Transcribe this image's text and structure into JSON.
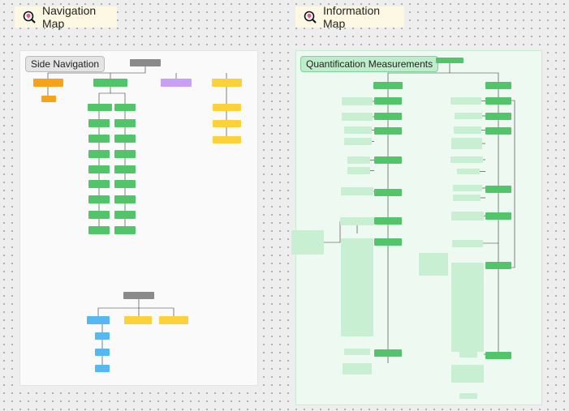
{
  "sections": {
    "navigation_map": {
      "title": "Navigation Map"
    },
    "information_map": {
      "title": "Information Map"
    }
  },
  "frames": {
    "side_navigation": {
      "label": "Side Navigation"
    },
    "quantification": {
      "label": "Quantification Measurements"
    }
  },
  "colors": {
    "gray": "#8a8a8a",
    "orange": "#f7a21b",
    "green": "#52c56b",
    "purple": "#c9a0f5",
    "yellow": "#fdd13a",
    "blue": "#55b8f2",
    "light_green": "#c8efd1",
    "teal_frame_bg": "#eefaf1",
    "teal_frame_border": "#c7ecd1"
  },
  "icons": {
    "section_icon": "brain-magnifier-icon"
  }
}
